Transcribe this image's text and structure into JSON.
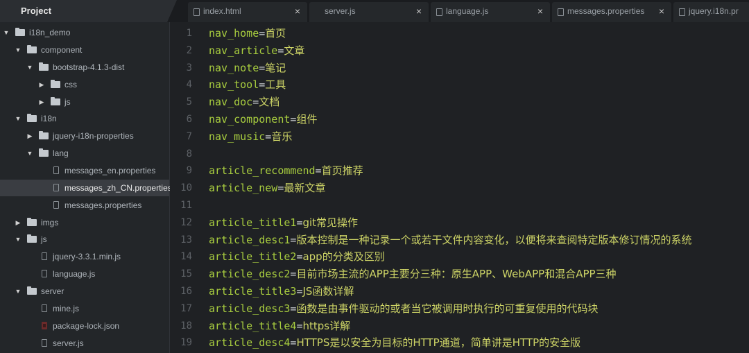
{
  "project_tab": {
    "label": "Project"
  },
  "tabs": [
    {
      "name": "index.html",
      "close": "×"
    },
    {
      "name": "server.js",
      "close": "×"
    },
    {
      "name": "language.js",
      "close": "×"
    },
    {
      "name": "messages.properties",
      "close": "×"
    },
    {
      "name": "jquery.i18n.pr",
      "close": ""
    }
  ],
  "tree": [
    {
      "label": "i18n_demo",
      "type": "folder",
      "expanded": true
    },
    {
      "label": "component",
      "type": "folder",
      "expanded": true
    },
    {
      "label": "bootstrap-4.1.3-dist",
      "type": "folder",
      "expanded": true
    },
    {
      "label": "css",
      "type": "folder",
      "expanded": false
    },
    {
      "label": "js",
      "type": "folder",
      "expanded": false
    },
    {
      "label": "i18n",
      "type": "folder",
      "expanded": true
    },
    {
      "label": "jquery-i18n-properties",
      "type": "folder",
      "expanded": false
    },
    {
      "label": "lang",
      "type": "folder",
      "expanded": true
    },
    {
      "label": "messages_en.properties",
      "type": "file"
    },
    {
      "label": "messages_zh_CN.properties",
      "type": "file",
      "selected": true
    },
    {
      "label": "messages.properties",
      "type": "file"
    },
    {
      "label": "imgs",
      "type": "folder",
      "expanded": false
    },
    {
      "label": "js",
      "type": "folder",
      "expanded": true
    },
    {
      "label": "jquery-3.3.1.min.js",
      "type": "file"
    },
    {
      "label": "language.js",
      "type": "file"
    },
    {
      "label": "server",
      "type": "folder",
      "expanded": true
    },
    {
      "label": "mine.js",
      "type": "file"
    },
    {
      "label": "package-lock.json",
      "type": "package"
    },
    {
      "label": "server.js",
      "type": "file"
    }
  ],
  "lines": [
    {
      "num": "1",
      "key": "nav_home",
      "val": "首页"
    },
    {
      "num": "2",
      "key": "nav_article",
      "val": "文章"
    },
    {
      "num": "3",
      "key": "nav_note",
      "val": "笔记"
    },
    {
      "num": "4",
      "key": "nav_tool",
      "val": "工具"
    },
    {
      "num": "5",
      "key": "nav_doc",
      "val": "文档"
    },
    {
      "num": "6",
      "key": "nav_component",
      "val": "组件"
    },
    {
      "num": "7",
      "key": "nav_music",
      "val": "音乐"
    },
    {
      "num": "8",
      "key": "",
      "val": ""
    },
    {
      "num": "9",
      "key": "article_recommend",
      "val": "首页推荐"
    },
    {
      "num": "10",
      "key": "article_new",
      "val": "最新文章"
    },
    {
      "num": "11",
      "key": "",
      "val": ""
    },
    {
      "num": "12",
      "key": "article_title1",
      "val": "git常见操作"
    },
    {
      "num": "13",
      "key": "article_desc1",
      "val": "版本控制是一种记录一个或若干文件内容变化，以便将来查阅特定版本修订情况的系统"
    },
    {
      "num": "14",
      "key": "article_title2",
      "val": "app的分类及区别"
    },
    {
      "num": "15",
      "key": "article_desc2",
      "val": "目前市场主流的APP主要分三种：原生APP、WebAPP和混合APP三种"
    },
    {
      "num": "16",
      "key": "article_title3",
      "val": "JS函数详解"
    },
    {
      "num": "17",
      "key": "article_desc3",
      "val": "函数是由事件驱动的或者当它被调用时执行的可重复使用的代码块"
    },
    {
      "num": "18",
      "key": "article_title4",
      "val": "https详解"
    },
    {
      "num": "19",
      "key": "article_desc4",
      "val": "HTTPS是以安全为目标的HTTP通道，简单讲是HTTP的安全版"
    }
  ]
}
